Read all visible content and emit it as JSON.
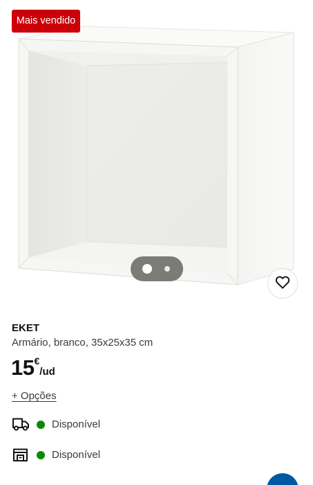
{
  "badge": {
    "label": "Mais vendido"
  },
  "carousel": {
    "total_images": 2,
    "active_index": 0
  },
  "favorite": {
    "icon": "heart-outline-icon"
  },
  "product": {
    "name": "EKET",
    "description": "Armário, branco, 35x25x35 cm",
    "price": {
      "integer": "15",
      "currency": "€",
      "unit": "/ud"
    },
    "options_label": "+ Opções"
  },
  "availability": {
    "delivery": {
      "icon": "truck-icon",
      "status": "Disponível",
      "status_color": "#0a8a00"
    },
    "store": {
      "icon": "store-icon",
      "status": "Disponível",
      "status_color": "#0a8a00"
    }
  },
  "colors": {
    "badge": "#cc0008",
    "available": "#0a8a00",
    "brand_blue": "#0058a3"
  }
}
